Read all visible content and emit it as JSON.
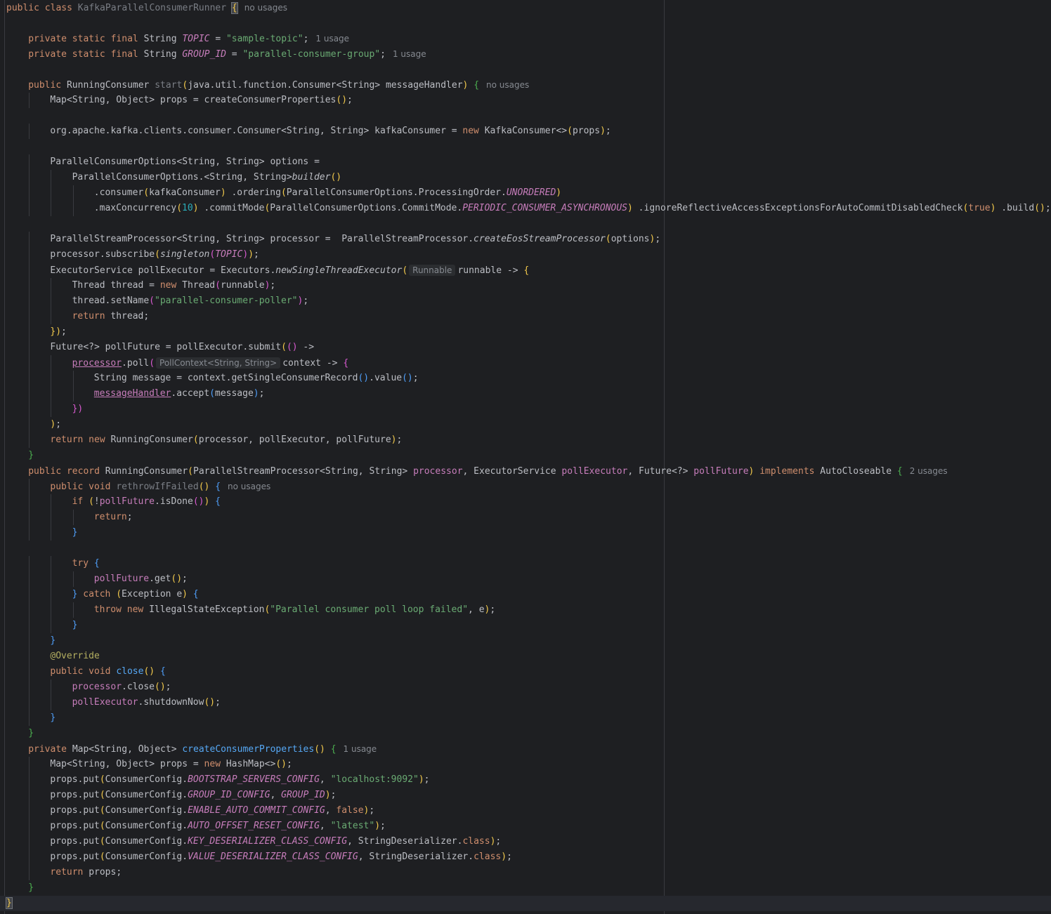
{
  "lines": [
    {
      "ind": 0,
      "html": "<span class=\"kw\">public class </span><span class=\"unused\">KafkaParallelConsumerRunner</span> <span class=\"caret-brace\">{</span><span class=\"hint\">no usages</span>"
    },
    {
      "ind": 0,
      "html": ""
    },
    {
      "ind": 1,
      "html": "<span class=\"kw\">private static final </span>String <span class=\"cst\">TOPIC</span> = <span class=\"str\">\"sample-topic\"</span>;<span class=\"hint\">1 usage</span>"
    },
    {
      "ind": 1,
      "html": "<span class=\"kw\">private static final </span>String <span class=\"cst\">GROUP_ID</span> = <span class=\"str\">\"parallel-consumer-group\"</span>;<span class=\"hint\">1 usage</span>"
    },
    {
      "ind": 0,
      "html": ""
    },
    {
      "ind": 1,
      "html": "<span class=\"kw\">public </span>RunningConsumer <span class=\"unused\">start</span><span class=\"p1\">(</span>java.util.function.Consumer&lt;String&gt; messageHandler<span class=\"p1\">)</span> <span class=\"p4\">{</span><span class=\"hint\">no usages</span>"
    },
    {
      "ind": 2,
      "html": "Map&lt;String, Object&gt; props = createConsumerProperties<span class=\"p1\">()</span>;"
    },
    {
      "ind": 0,
      "html": ""
    },
    {
      "ind": 2,
      "html": "org.apache.kafka.clients.consumer.Consumer&lt;String, String&gt; kafkaConsumer = <span class=\"kw\">new </span>KafkaConsumer&lt;&gt;<span class=\"p1\">(</span>props<span class=\"p1\">)</span>;"
    },
    {
      "ind": 0,
      "html": ""
    },
    {
      "ind": 2,
      "html": "ParallelConsumerOptions&lt;String, String&gt; options ="
    },
    {
      "ind": 3,
      "html": "ParallelConsumerOptions.&lt;String, String&gt;<span class=\"sm\">builder</span><span class=\"p1\">()</span>"
    },
    {
      "ind": 4,
      "html": ".consumer<span class=\"p1\">(</span>kafkaConsumer<span class=\"p1\">)</span> .ordering<span class=\"p1\">(</span>ParallelConsumerOptions.ProcessingOrder.<span class=\"cst\">UNORDERED</span><span class=\"p1\">)</span>"
    },
    {
      "ind": 4,
      "html": ".maxConcurrency<span class=\"p1\">(</span><span class=\"num\">10</span><span class=\"p1\">)</span> .commitMode<span class=\"p1\">(</span>ParallelConsumerOptions.CommitMode.<span class=\"cst\">PERIODIC_CONSUMER_ASYNCHRONOUS</span><span class=\"p1\">)</span> .ignoreReflectiveAccessExceptionsForAutoCommitDisabledCheck<span class=\"p1\">(</span><span class=\"kw\">true</span><span class=\"p1\">)</span> .build<span class=\"p1\">()</span>;"
    },
    {
      "ind": 0,
      "html": ""
    },
    {
      "ind": 2,
      "html": "ParallelStreamProcessor&lt;String, String&gt; processor =  ParallelStreamProcessor.<span class=\"sm\">createEosStreamProcessor</span><span class=\"p1\">(</span>options<span class=\"p1\">)</span>;"
    },
    {
      "ind": 2,
      "html": "processor.subscribe<span class=\"p1\">(</span><span class=\"sm\">singleton</span><span class=\"p2\">(</span><span class=\"cst\">TOPIC</span><span class=\"p2\">)</span><span class=\"p1\">)</span>;"
    },
    {
      "ind": 2,
      "html": "ExecutorService pollExecutor = Executors.<span class=\"sm\">newSingleThreadExecutor</span><span class=\"p1\">(</span><span class=\"inlay\">Runnable</span>runnable -&gt; <span class=\"p1\">{</span>"
    },
    {
      "ind": 3,
      "html": "Thread thread = <span class=\"kw\">new </span>Thread<span class=\"p2\">(</span>runnable<span class=\"p2\">)</span>;"
    },
    {
      "ind": 3,
      "html": "thread.setName<span class=\"p2\">(</span><span class=\"str\">\"parallel-consumer-poller\"</span><span class=\"p2\">)</span>;"
    },
    {
      "ind": 3,
      "html": "<span class=\"kw\">return </span>thread;"
    },
    {
      "ind": 2,
      "html": "<span class=\"p1\">})</span>;"
    },
    {
      "ind": 2,
      "html": "Future&lt;?&gt; pollFuture = pollExecutor.submit<span class=\"p1\">(</span><span class=\"p2\">()</span> -&gt;"
    },
    {
      "ind": 3,
      "html": "<span class=\"ulv\">processor</span>.poll<span class=\"p2\">(</span><span class=\"inlay\">PollContext&lt;String, String&gt;</span>context -&gt; <span class=\"p2\">{</span>"
    },
    {
      "ind": 4,
      "html": "String message = context.getSingleConsumerRecord<span class=\"p3\">()</span>.value<span class=\"p3\">()</span>;"
    },
    {
      "ind": 4,
      "html": "<span class=\"ulv\">messageHandler</span>.accept<span class=\"p3\">(</span>message<span class=\"p3\">)</span>;"
    },
    {
      "ind": 3,
      "html": "<span class=\"p2\">})</span>"
    },
    {
      "ind": 2,
      "html": "<span class=\"p1\">)</span>;"
    },
    {
      "ind": 2,
      "html": "<span class=\"kw\">return new </span>RunningConsumer<span class=\"p1\">(</span>processor, pollExecutor, pollFuture<span class=\"p1\">)</span>;"
    },
    {
      "ind": 1,
      "html": "<span class=\"p4\">}</span>"
    },
    {
      "ind": 1,
      "html": "<span class=\"kw\">public record </span>RunningConsumer<span class=\"p1\">(</span>ParallelStreamProcessor&lt;String, String&gt; <span class=\"fld\">processor</span>, ExecutorService <span class=\"fld\">pollExecutor</span>, Future&lt;?&gt; <span class=\"fld\">pollFuture</span><span class=\"p1\">)</span> <span class=\"kw\">implements </span>AutoCloseable <span class=\"p4\">{</span><span class=\"hint\">2 usages</span>"
    },
    {
      "ind": 2,
      "html": "<span class=\"kw\">public void </span><span class=\"unused\">rethrowIfFailed</span><span class=\"p1\">()</span> <span class=\"p3\">{</span><span class=\"hint\">no usages</span>"
    },
    {
      "ind": 3,
      "html": "<span class=\"kw\">if </span><span class=\"p1\">(</span>!<span class=\"fld\">pollFuture</span>.isDone<span class=\"p2\">()</span><span class=\"p1\">)</span> <span class=\"p3\">{</span>"
    },
    {
      "ind": 4,
      "html": "<span class=\"kw\">return</span>;"
    },
    {
      "ind": 3,
      "html": "<span class=\"p3\">}</span>"
    },
    {
      "ind": 0,
      "html": ""
    },
    {
      "ind": 3,
      "html": "<span class=\"kw\">try </span><span class=\"p3\">{</span>"
    },
    {
      "ind": 4,
      "html": "<span class=\"fld\">pollFuture</span>.get<span class=\"p1\">()</span>;"
    },
    {
      "ind": 3,
      "html": "<span class=\"p3\">}</span> <span class=\"kw\">catch </span><span class=\"p1\">(</span>Exception e<span class=\"p1\">)</span> <span class=\"p3\">{</span>"
    },
    {
      "ind": 4,
      "html": "<span class=\"kw\">throw new </span>IllegalStateException<span class=\"p1\">(</span><span class=\"str\">\"Parallel consumer poll loop failed\"</span>, e<span class=\"p1\">)</span>;"
    },
    {
      "ind": 3,
      "html": "<span class=\"p3\">}</span>"
    },
    {
      "ind": 2,
      "html": "<span class=\"p3\">}</span>"
    },
    {
      "ind": 2,
      "html": "<span class=\"ann\">@Override</span>"
    },
    {
      "ind": 2,
      "html": "<span class=\"kw\">public void </span><span class=\"mdecl\">close</span><span class=\"p1\">()</span> <span class=\"p3\">{</span>"
    },
    {
      "ind": 3,
      "html": "<span class=\"fld\">processor</span>.close<span class=\"p1\">()</span>;"
    },
    {
      "ind": 3,
      "html": "<span class=\"fld\">pollExecutor</span>.shutdownNow<span class=\"p1\">()</span>;"
    },
    {
      "ind": 2,
      "html": "<span class=\"p3\">}</span>"
    },
    {
      "ind": 1,
      "html": "<span class=\"p4\">}</span>"
    },
    {
      "ind": 1,
      "html": "<span class=\"kw\">private </span>Map&lt;String, Object&gt; <span class=\"mdecl\">createConsumerProperties</span><span class=\"p1\">()</span> <span class=\"p4\">{</span><span class=\"hint\">1 usage</span>"
    },
    {
      "ind": 2,
      "html": "Map&lt;String, Object&gt; props = <span class=\"kw\">new </span>HashMap&lt;&gt;<span class=\"p1\">()</span>;"
    },
    {
      "ind": 2,
      "html": "props.put<span class=\"p1\">(</span>ConsumerConfig.<span class=\"cst\">BOOTSTRAP_SERVERS_CONFIG</span>, <span class=\"str\">\"localhost:9092\"</span><span class=\"p1\">)</span>;"
    },
    {
      "ind": 2,
      "html": "props.put<span class=\"p1\">(</span>ConsumerConfig.<span class=\"cst\">GROUP_ID_CONFIG</span>, <span class=\"cst\">GROUP_ID</span><span class=\"p1\">)</span>;"
    },
    {
      "ind": 2,
      "html": "props.put<span class=\"p1\">(</span>ConsumerConfig.<span class=\"cst\">ENABLE_AUTO_COMMIT_CONFIG</span>, <span class=\"kw\">false</span><span class=\"p1\">)</span>;"
    },
    {
      "ind": 2,
      "html": "props.put<span class=\"p1\">(</span>ConsumerConfig.<span class=\"cst\">AUTO_OFFSET_RESET_CONFIG</span>, <span class=\"str\">\"latest\"</span><span class=\"p1\">)</span>;"
    },
    {
      "ind": 2,
      "html": "props.put<span class=\"p1\">(</span>ConsumerConfig.<span class=\"cst\">KEY_DESERIALIZER_CLASS_CONFIG</span>, StringDeserializer.<span class=\"kw\">class</span><span class=\"p1\">)</span>;"
    },
    {
      "ind": 2,
      "html": "props.put<span class=\"p1\">(</span>ConsumerConfig.<span class=\"cst\">VALUE_DESERIALIZER_CLASS_CONFIG</span>, StringDeserializer.<span class=\"kw\">class</span><span class=\"p1\">)</span>;"
    },
    {
      "ind": 2,
      "html": "<span class=\"kw\">return </span>props;"
    },
    {
      "ind": 1,
      "html": "<span class=\"p4\">}</span>"
    },
    {
      "ind": 0,
      "html": "<span class=\"caret-brace\">}</span>",
      "current": true
    }
  ],
  "colors": {
    "background": "#1e1f22",
    "keyword": "#cf8e6d",
    "string": "#6aab73",
    "number": "#2aacb8",
    "constant": "#c77dbb",
    "method_declaration": "#56a8f5",
    "annotation": "#b3ae60",
    "hint": "#868a91"
  }
}
